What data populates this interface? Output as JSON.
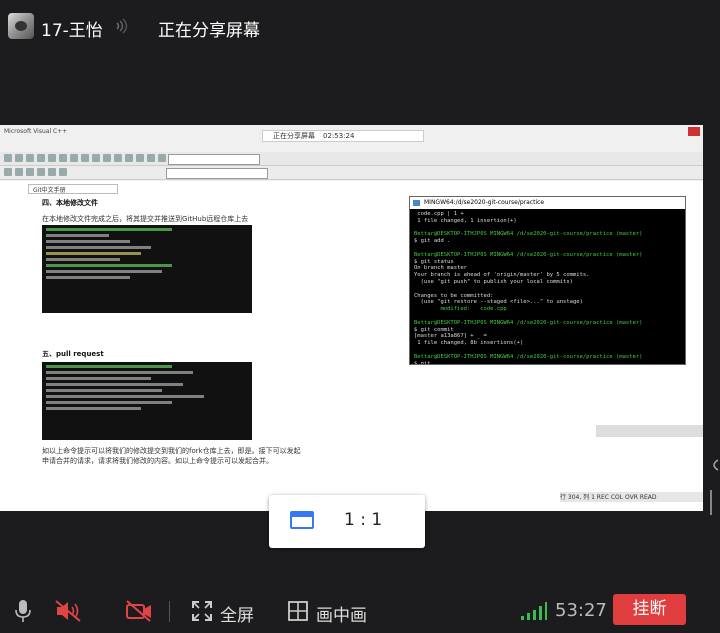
{
  "header": {
    "username": "17-王怡",
    "share_status": "正在分享屏幕"
  },
  "shared_screen": {
    "share_indicator": "正在分享屏幕",
    "share_time": "02:53:24",
    "app_title": "Microsoft Visual C++",
    "doc_tab": "Git中文手册",
    "doc_heading": "四、本地修改文件",
    "doc_text": "在本地修改文件完成之后，将其提交并推送到GitHub远程仓库上去",
    "doc_sub": "五、pull request",
    "doc_text2": "如以上命令提示可以将我们的修改提交到我们的fork仓库上去，即是。接下可以发起申请合并的请求，请求将我们修改的内容。如以上命令提示可以发起合并。",
    "terminal": {
      "title": "MINGW64:/d/se2020-git-course/practice",
      "lines": [
        {
          "t": " code.cpp | 1 +",
          "c": "t-w"
        },
        {
          "t": " 1 file changed, 1 insertion(+)",
          "c": "t-w"
        },
        {
          "t": "",
          "c": "t-w"
        },
        {
          "t": "Bettar@DESKTOP-ITHJP0S MINGW64 /d/se2020-git-course/practice (master)",
          "c": "t-g"
        },
        {
          "t": "$ git add .",
          "c": "t-w"
        },
        {
          "t": "",
          "c": "t-w"
        },
        {
          "t": "Bettar@DESKTOP-ITHJP0S MINGW64 /d/se2020-git-course/practice (master)",
          "c": "t-g"
        },
        {
          "t": "$ git status",
          "c": "t-w"
        },
        {
          "t": "On branch master",
          "c": "t-w"
        },
        {
          "t": "Your branch is ahead of 'origin/master' by 5 commits.",
          "c": "t-w"
        },
        {
          "t": "  (use \"git push\" to publish your local commits)",
          "c": "t-w"
        },
        {
          "t": "",
          "c": "t-w"
        },
        {
          "t": "Changes to be committed:",
          "c": "t-w"
        },
        {
          "t": "  (use \"git restore --staged <file>...\" to unstage)",
          "c": "t-w"
        },
        {
          "t": "        modified:   code.cpp",
          "c": "t-g"
        },
        {
          "t": "",
          "c": "t-w"
        },
        {
          "t": "Bettar@DESKTOP-ITHJP0S MINGW64 /d/se2020-git-course/practice (master)",
          "c": "t-g"
        },
        {
          "t": "$ git commit",
          "c": "t-w"
        },
        {
          "t": "[master a13a867] + _ =",
          "c": "t-w"
        },
        {
          "t": " 1 file changed, 8b insertions(+)",
          "c": "t-w"
        },
        {
          "t": "",
          "c": "t-w"
        },
        {
          "t": "Bettar@DESKTOP-ITHJP0S MINGW64 /d/se2020-git-course/practice (master)",
          "c": "t-g"
        },
        {
          "t": "$ git",
          "c": "t-w"
        }
      ]
    },
    "status_bar": "行 304, 列 1  REC COL OVR READ"
  },
  "ratio_popup": {
    "label": "1 : 1"
  },
  "controls": {
    "fullscreen_label": "全屏",
    "pip_label": "画中画",
    "timer": "53:27",
    "hangup_label": "挂断"
  }
}
